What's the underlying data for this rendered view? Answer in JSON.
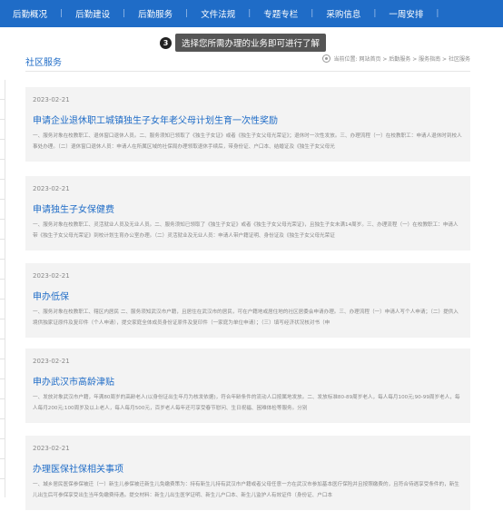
{
  "nav": {
    "items": [
      "后勤概况",
      "后勤建设",
      "后勤服务",
      "文件法规",
      "专题专栏",
      "采购信息",
      "一周安排"
    ],
    "separator": "|"
  },
  "tooltip": {
    "step": "3",
    "text": "选择您所需办理的业务即可进行了解"
  },
  "page": {
    "section_title": "社区服务",
    "location": "当前位置: 网站首页 > 后勤服务 > 服务指南 > 社区服务"
  },
  "articles": [
    {
      "date": "2023-02-21",
      "title": "申请企业退休职工城镇独生子女年老父母计划生育一次性奖励",
      "desc": "一、服务对象在校教职工、退休窗口退休人员。二、服务须知已领取了《独生子女证》或者《独生子女父母光荣证》；退休时一次性发放。三、办理流程（一）在校教职工：申请人退休时到校人事处办理。（二）退休窗口退休人员：申请人在所属区域的社保局办理领取退休手续后，带身份证、户口本、结婚证及《独生子女父母光"
    },
    {
      "date": "2023-02-21",
      "title": "申请独生子女保健费",
      "desc": "一、服务对象在校教职工、灵活就业人员及无业人员。二、服务须知已领取了《独生子女证》或者《独生子女父母光荣证》，且独生子女未满14周岁。三、办理流程（一）在校教职工：申请人带《独生子女父母光荣证》到校计划生育办公室办理。（二）灵活就业及无业人员：申请人带户籍证明、身份证及《独生子女父母光荣证"
    },
    {
      "date": "2023-02-21",
      "title": "申办低保",
      "desc": "一、服务对象在校教职工、辖区内居民 二、服务须知武汉市户籍，且居住在武汉市的居民，可在户籍地或居住地的社区居委会申请办理。三、办理流程（一）申请人写个人申请；（二）提供入境供独家证原件及复印件（个人申请），提交家庭全体成员身份证原件及复印件（一家庭为单位申请）；（三）填写经济状况核对书（申"
    },
    {
      "date": "2023-02-21",
      "title": "申办武汉市高龄津贴",
      "desc": "一、发放对象武汉市户籍，年满80周岁的高龄老人(以身份证出生年月为核发依据)，符合年龄条件的流动人口按属地发放。二、发放标准80-89周岁老人，每人每月100元;90-99周岁老人，每人每月200元;100周岁及以上老人，每人每月500元，百岁老人每年还可享受春节慰问、生日祝福、困难体检等服务。分别"
    },
    {
      "date": "2023-02-21",
      "title": "办理医保社保相关事项",
      "desc": "一、城乡居民医保参保被迁（一）新生儿参保被迁新生儿免缴费策为：持有新生儿持有武汉市户籍或者父母任意一方在武汉市参加基本医疗保险并且按照缴费的，且符合待遇享受条件的，新生儿出生后可参保享受出生当年免缴费待遇。提交材料：新生儿出生医学证明、新生儿户口本、新生儿监护人有效证件（身份证、户口本"
    }
  ]
}
